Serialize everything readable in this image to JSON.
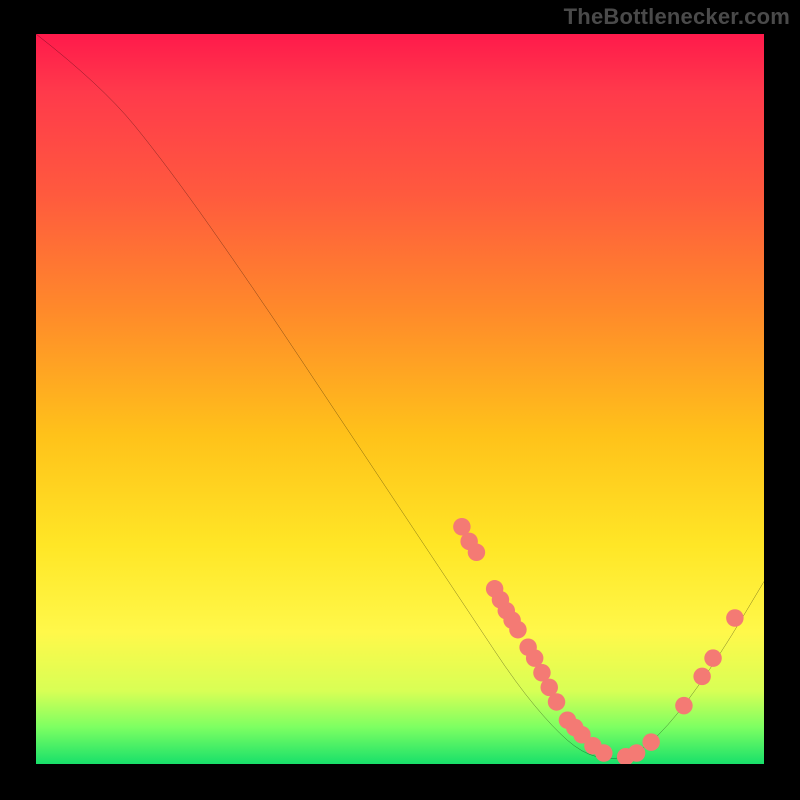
{
  "attribution": "TheBottlenecker.com",
  "chart_data": {
    "type": "line",
    "title": "",
    "xlabel": "",
    "ylabel": "",
    "xlim": [
      0,
      100
    ],
    "ylim": [
      0,
      100
    ],
    "curve": [
      {
        "x": 0,
        "y": 100
      },
      {
        "x": 9,
        "y": 93
      },
      {
        "x": 18,
        "y": 82
      },
      {
        "x": 30,
        "y": 65
      },
      {
        "x": 42,
        "y": 47
      },
      {
        "x": 54,
        "y": 29
      },
      {
        "x": 60,
        "y": 20
      },
      {
        "x": 66,
        "y": 11
      },
      {
        "x": 71,
        "y": 5
      },
      {
        "x": 75,
        "y": 1.5
      },
      {
        "x": 79,
        "y": 0.5
      },
      {
        "x": 83,
        "y": 1.5
      },
      {
        "x": 88,
        "y": 6.5
      },
      {
        "x": 94,
        "y": 15
      },
      {
        "x": 100,
        "y": 25
      }
    ],
    "markers": [
      {
        "x": 58.5,
        "y": 32.5
      },
      {
        "x": 59.5,
        "y": 30.5
      },
      {
        "x": 60.5,
        "y": 29
      },
      {
        "x": 63,
        "y": 24
      },
      {
        "x": 63.8,
        "y": 22.5
      },
      {
        "x": 64.6,
        "y": 21
      },
      {
        "x": 65.4,
        "y": 19.7
      },
      {
        "x": 66.2,
        "y": 18.4
      },
      {
        "x": 67.6,
        "y": 16
      },
      {
        "x": 68.5,
        "y": 14.5
      },
      {
        "x": 69.5,
        "y": 12.5
      },
      {
        "x": 70.5,
        "y": 10.5
      },
      {
        "x": 71.5,
        "y": 8.5
      },
      {
        "x": 73,
        "y": 6
      },
      {
        "x": 74,
        "y": 5
      },
      {
        "x": 75,
        "y": 4
      },
      {
        "x": 76.5,
        "y": 2.5
      },
      {
        "x": 78,
        "y": 1.5
      },
      {
        "x": 81,
        "y": 1
      },
      {
        "x": 82.5,
        "y": 1.5
      },
      {
        "x": 84.5,
        "y": 3
      },
      {
        "x": 89,
        "y": 8
      },
      {
        "x": 91.5,
        "y": 12
      },
      {
        "x": 93,
        "y": 14.5
      },
      {
        "x": 96,
        "y": 20
      }
    ],
    "marker_color": "#f47a74",
    "marker_radius_pct": 1.2,
    "curve_color": "#000000",
    "background_gradient": [
      "#ff1a4b",
      "#ff5a3e",
      "#ffc21a",
      "#fff84a",
      "#18e06a"
    ]
  }
}
